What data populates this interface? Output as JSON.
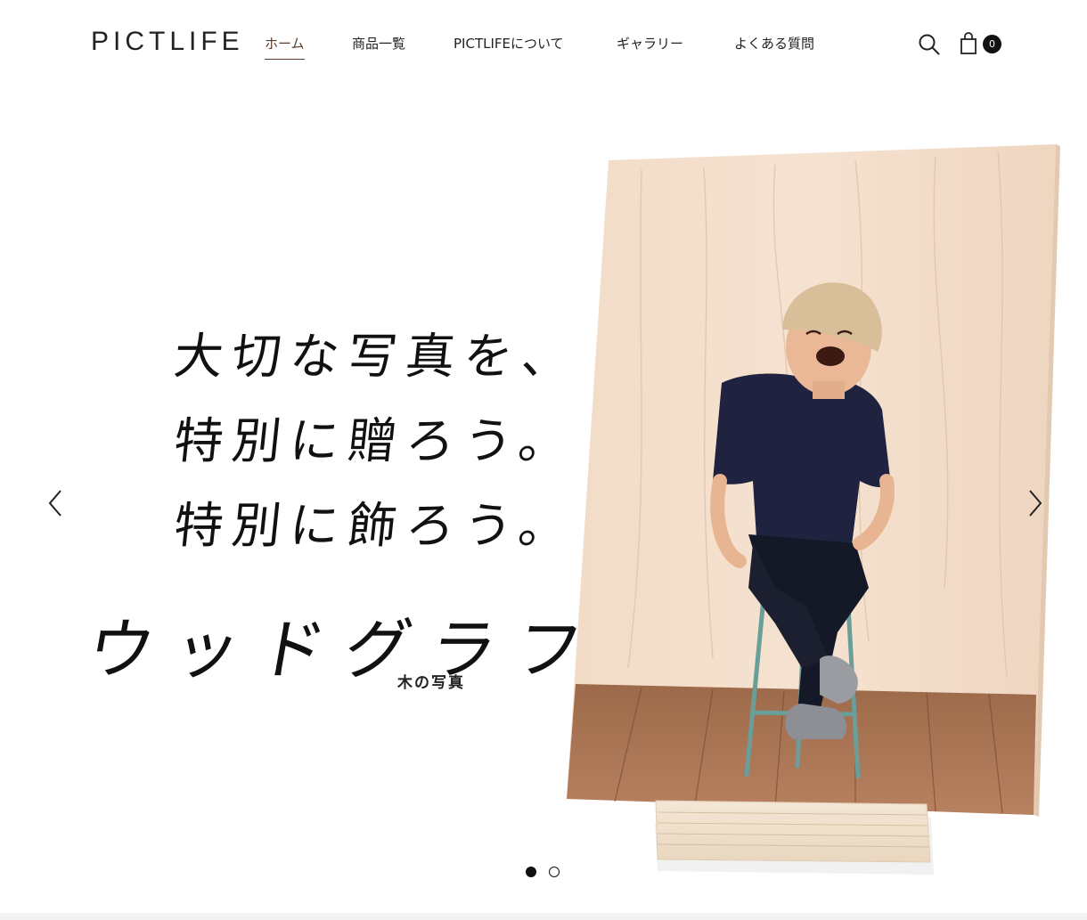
{
  "header": {
    "logo": "PICTLIFE",
    "nav": [
      {
        "label": "ホーム",
        "active": true
      },
      {
        "label": "商品一覧",
        "active": false
      },
      {
        "label": "PICTLIFEについて",
        "active": false
      },
      {
        "label": "ギャラリー",
        "active": false
      },
      {
        "label": "よくある質問",
        "active": false
      }
    ],
    "search_icon": "search-icon",
    "cart_icon": "shopping-bag-icon",
    "cart_count": "0"
  },
  "hero": {
    "headline": [
      "大切な写真を、",
      "特別に贈ろう。",
      "特別に飾ろう。"
    ],
    "brand_title": "ウッドグラフ",
    "brand_subtitle": "木の写真",
    "prev_icon": "chevron-left-icon",
    "next_icon": "chevron-right-icon",
    "slides_total": 2,
    "slide_active": 1
  },
  "colors": {
    "active_nav": "#5a3b2a",
    "wood_light": "#f0d9c4",
    "floor": "#a8704a"
  }
}
